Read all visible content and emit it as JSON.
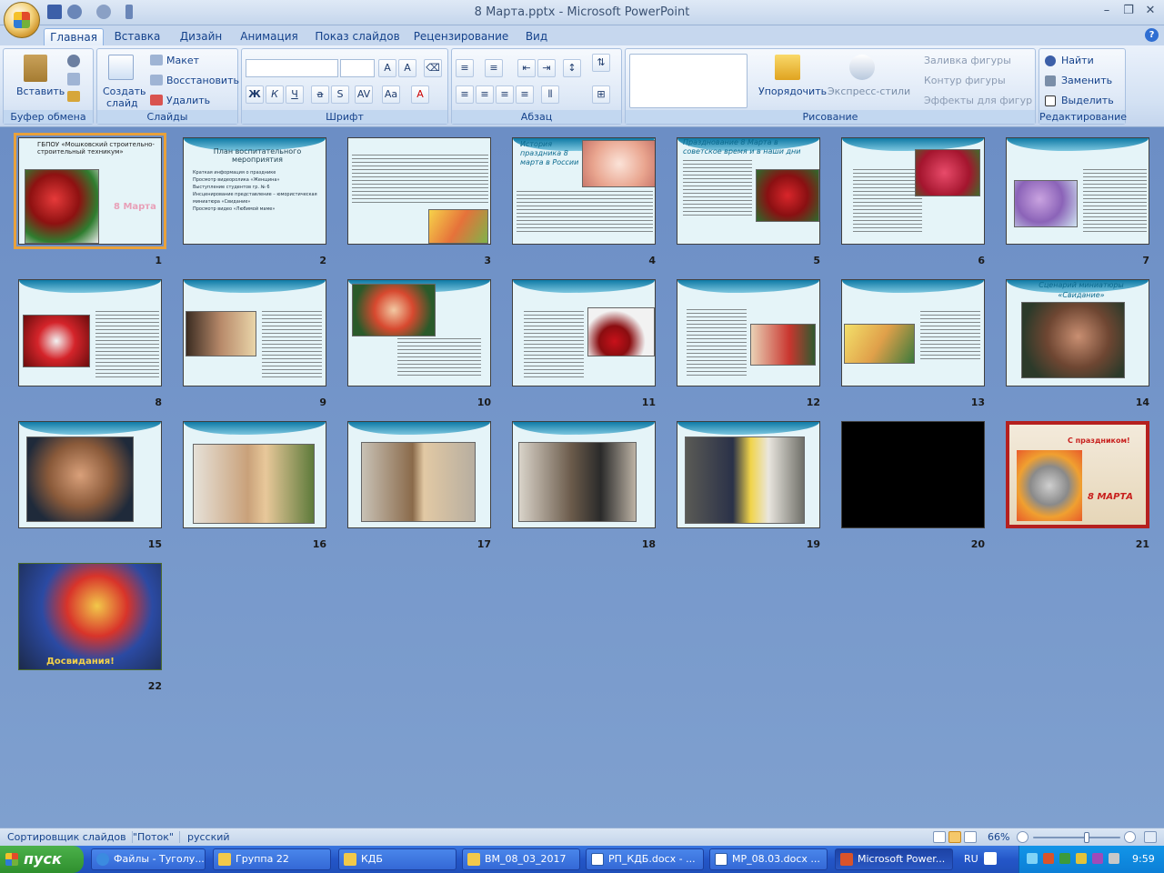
{
  "window": {
    "title": "8 Марта.pptx - Microsoft PowerPoint"
  },
  "tabs": [
    "Главная",
    "Вставка",
    "Дизайн",
    "Анимация",
    "Показ слайдов",
    "Рецензирование",
    "Вид"
  ],
  "ribbon": {
    "clipboard": {
      "label": "Буфер обмена",
      "paste": "Вставить"
    },
    "slides": {
      "label": "Слайды",
      "create": "Создать",
      "create2": "слайд",
      "layout": "Макет",
      "reset": "Восстановить",
      "delete": "Удалить"
    },
    "font": {
      "label": "Шрифт"
    },
    "paragraph": {
      "label": "Абзац"
    },
    "drawing": {
      "label": "Рисование",
      "arrange": "Упорядочить",
      "quick_styles": "Экспресс-стили",
      "fill": "Заливка фигуры",
      "outline": "Контур фигуры",
      "effects": "Эффекты для фигур"
    },
    "editing": {
      "label": "Редактирование",
      "find": "Найти",
      "replace": "Заменить",
      "select": "Выделить"
    }
  },
  "slides": [
    {
      "n": "1",
      "title": "ГБПОУ «Мошковский строительно-строительный техникум»",
      "subtitle": "8 Марта"
    },
    {
      "n": "2",
      "title": "План воспитательного мероприятия",
      "bullets": [
        "Краткая информация о празднике",
        "Просмотр видеоролика «Женщина»",
        "Выступление студентов гр. № 6",
        "Инсценирование представление – юмористическая миниатюра «Свидание»",
        "Просмотр видео «Любимой маме»"
      ]
    },
    {
      "n": "3"
    },
    {
      "n": "4",
      "title": "История праздника 8 марта в России"
    },
    {
      "n": "5",
      "title": "Празднование 8 Марта в советское время и в наши дни"
    },
    {
      "n": "6"
    },
    {
      "n": "7"
    },
    {
      "n": "8"
    },
    {
      "n": "9"
    },
    {
      "n": "10"
    },
    {
      "n": "11"
    },
    {
      "n": "12"
    },
    {
      "n": "13"
    },
    {
      "n": "14",
      "title": "Сценарий миниатюры «Свидание»"
    },
    {
      "n": "15"
    },
    {
      "n": "16"
    },
    {
      "n": "17"
    },
    {
      "n": "18"
    },
    {
      "n": "19"
    },
    {
      "n": "20"
    },
    {
      "n": "21",
      "title": "С праздником!",
      "subtitle": "8 МАРТА"
    },
    {
      "n": "22",
      "title": "Досвидания!"
    }
  ],
  "status": {
    "view": "Сортировщик слайдов",
    "theme": "\"Поток\"",
    "language": "русский",
    "zoom": "66%"
  },
  "taskbar": {
    "start": "пуск",
    "items": [
      "Файлы - Туголу...",
      "Группа 22",
      "КДБ",
      "ВМ_08_03_2017",
      "РП_КДБ.docx - ...",
      "МР_08.03.docx ...",
      "Microsoft Power..."
    ],
    "lang": "RU",
    "time": "9:59"
  }
}
